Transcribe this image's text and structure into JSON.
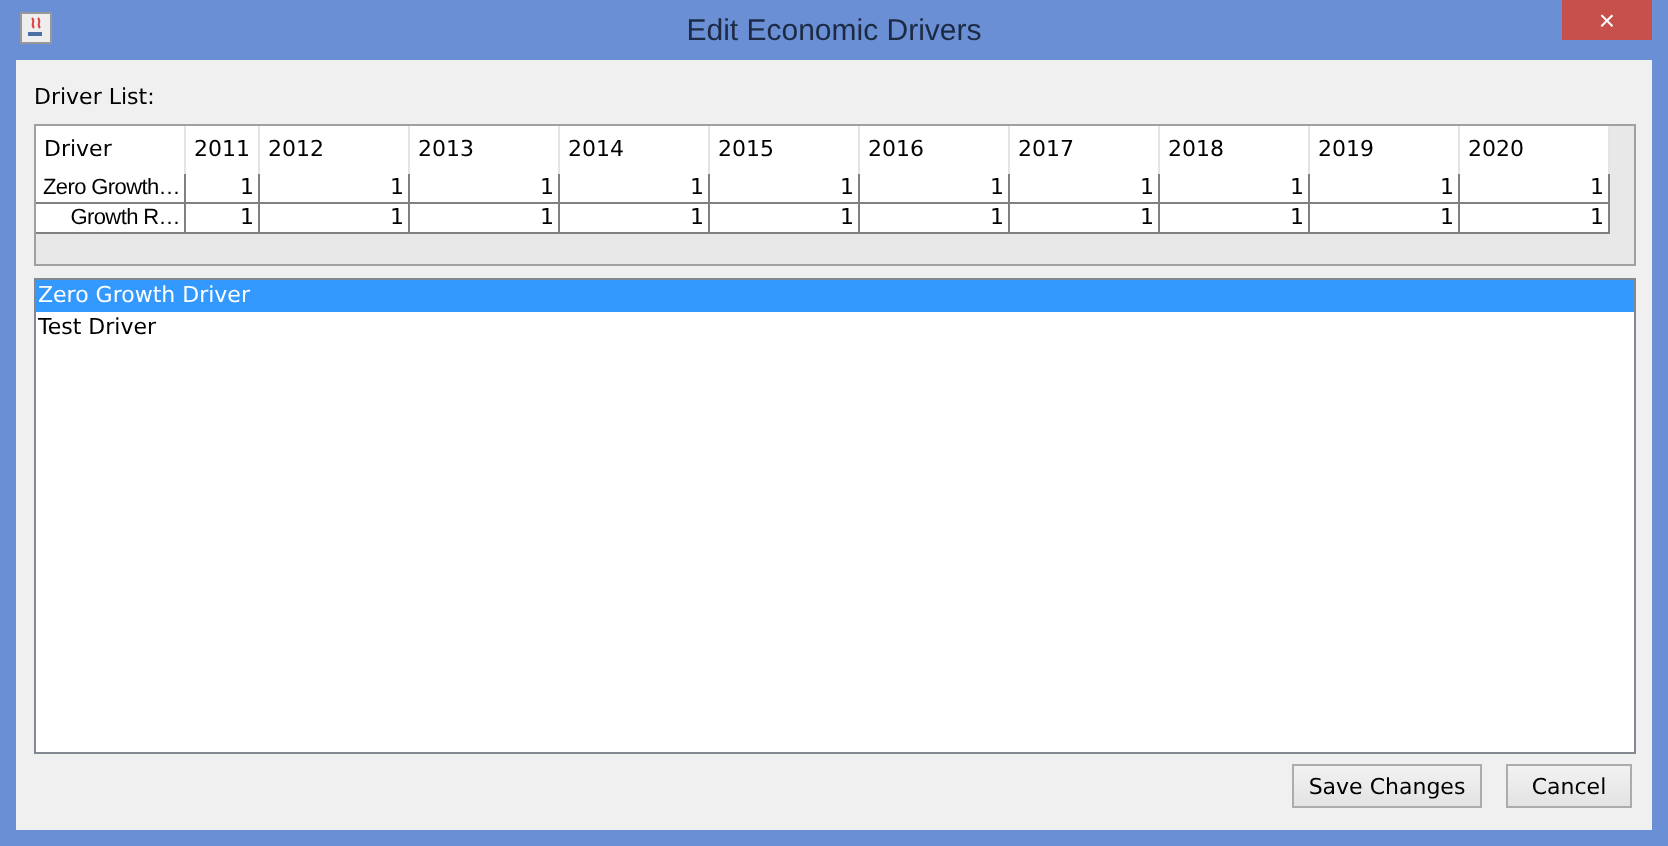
{
  "window": {
    "title": "Edit Economic Drivers",
    "close": "×"
  },
  "label": "Driver List:",
  "table": {
    "columns": [
      "Driver",
      "2011",
      "2012",
      "2013",
      "2014",
      "2015",
      "2016",
      "2017",
      "2018",
      "2019",
      "2020"
    ],
    "rows": [
      [
        "Zero Growth…",
        "1",
        "1",
        "1",
        "1",
        "1",
        "1",
        "1",
        "1",
        "1",
        "1"
      ],
      [
        "Growth R…",
        "1",
        "1",
        "1",
        "1",
        "1",
        "1",
        "1",
        "1",
        "1",
        "1"
      ]
    ]
  },
  "list": [
    {
      "label": "Zero Growth Driver",
      "selected": true
    },
    {
      "label": "Test Driver",
      "selected": false
    }
  ],
  "buttons": [
    "Save Changes",
    "Cancel"
  ]
}
